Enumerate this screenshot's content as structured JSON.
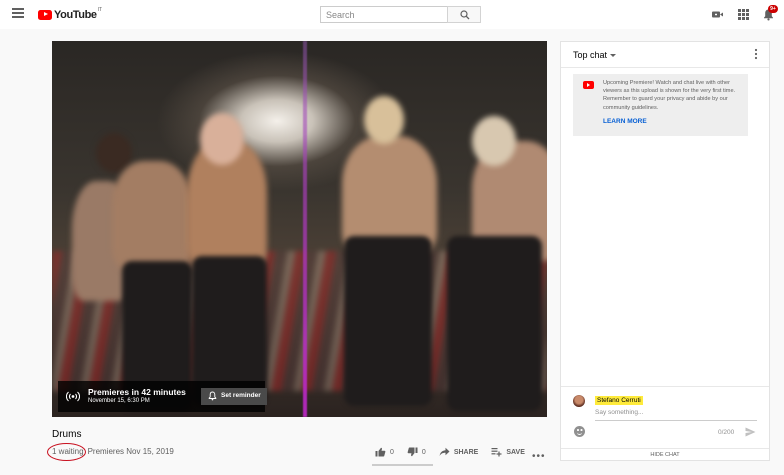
{
  "header": {
    "logo_text": "YouTube",
    "logo_country": "IT",
    "search_placeholder": "Search",
    "notification_count": "9+"
  },
  "video": {
    "premiere_title": "Premieres in 42 minutes",
    "premiere_date": "November 15, 6:30 PM",
    "reminder_label": "Set reminder",
    "title": "Drums",
    "waiting": "1 waiting",
    "premiere_info": "Premieres Nov 15, 2019"
  },
  "actions": {
    "likes": "0",
    "dislikes": "0",
    "share_label": "SHARE",
    "save_label": "SAVE"
  },
  "chat": {
    "mode_label": "Top chat",
    "notice_text": "Upcoming Premiere! Watch and chat live with other viewers as this upload is shown for the very first time. Remember to guard your privacy and abide by our community guidelines.",
    "learn_more": "LEARN MORE",
    "author_name": "Stefano Cerruti",
    "input_placeholder": "Say something...",
    "char_count": "0/200",
    "hide_chat": "HIDE CHAT"
  },
  "colors": {
    "brand_red": "#ff0000",
    "link_blue": "#065fd4",
    "highlight_yellow": "#ffeb3b",
    "annotation_red": "#c8101f"
  }
}
